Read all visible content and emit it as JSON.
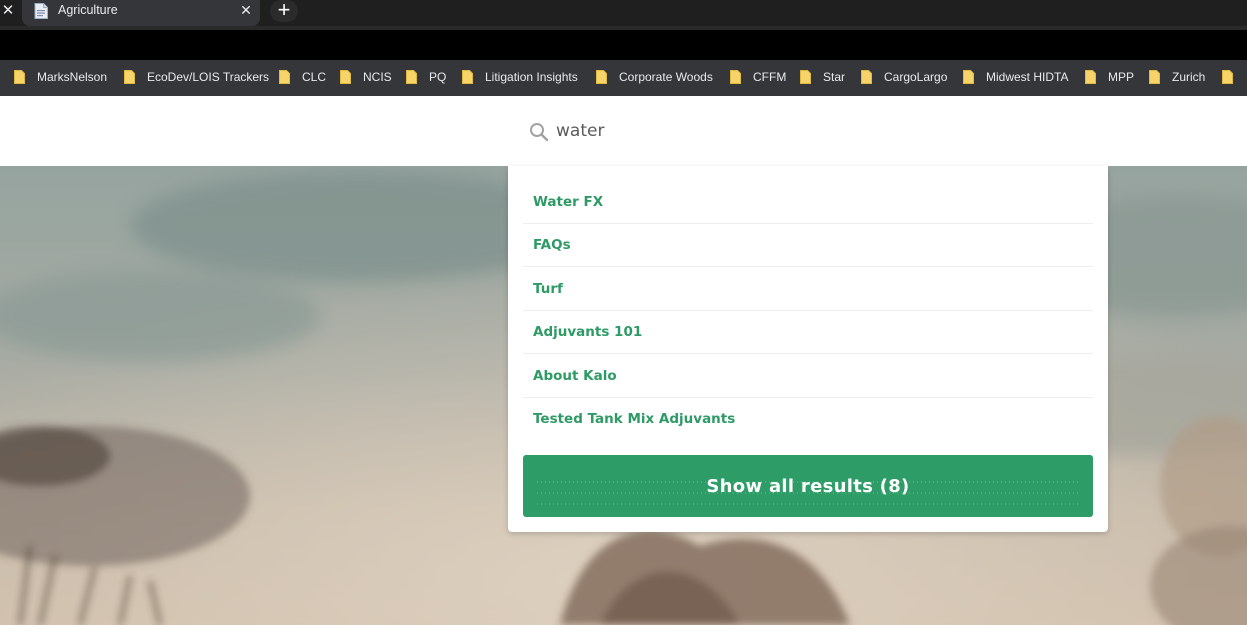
{
  "browser": {
    "tab_title": "Agriculture",
    "prev_tab_close_glyph": "✕",
    "tab_close_glyph": "✕",
    "new_tab_glyph": "+",
    "tab_favicon_icon": "document-icon",
    "bookmark_icon": "folder-icon",
    "bookmarks": [
      {
        "label": "MarksNelson"
      },
      {
        "label": "EcoDev/LOIS Trackers"
      },
      {
        "label": "CLC"
      },
      {
        "label": "NCIS"
      },
      {
        "label": "PQ"
      },
      {
        "label": "Litigation Insights"
      },
      {
        "label": "Corporate Woods"
      },
      {
        "label": "CFFM"
      },
      {
        "label": "Star"
      },
      {
        "label": "CargoLargo"
      },
      {
        "label": "Midwest HIDTA"
      },
      {
        "label": "MPP"
      },
      {
        "label": "Zurich"
      },
      {
        "label": ""
      }
    ]
  },
  "search": {
    "value": "water",
    "icon": "search-icon"
  },
  "results": [
    {
      "label": "Water FX"
    },
    {
      "label": "FAQs"
    },
    {
      "label": "Turf"
    },
    {
      "label": "Adjuvants 101"
    },
    {
      "label": "About Kalo"
    },
    {
      "label": "Tested Tank Mix Adjuvants"
    }
  ],
  "show_all_label": "Show all results (8)",
  "colors": {
    "accent_green": "#2e9c67",
    "link_green": "#2e9a65",
    "bookmark_folder": "#f6d469",
    "tab_bg": "#35363a"
  }
}
